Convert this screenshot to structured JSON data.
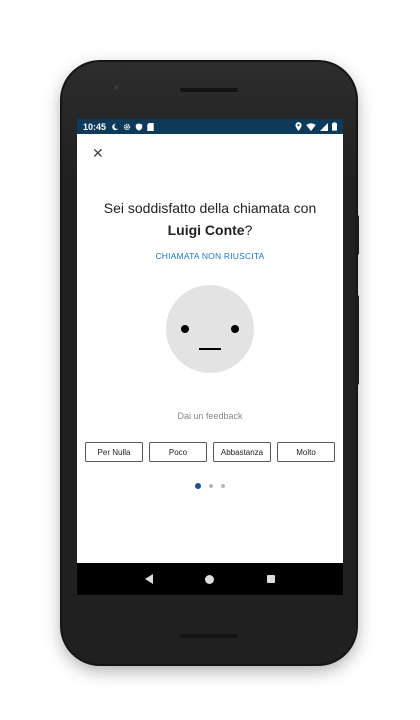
{
  "status_bar": {
    "time": "10:45",
    "left_icons": [
      "moon-icon",
      "settings-icon",
      "shield-icon",
      "sd-card-icon"
    ],
    "right_icons": [
      "location-icon",
      "wifi-icon",
      "signal-icon",
      "battery-icon"
    ]
  },
  "dialog": {
    "question_prefix": "Sei soddisfatto della chiamata con ",
    "contact_name": "Luigi Conte",
    "question_suffix": "?",
    "failed_call_link": "CHIAMATA NON RIUSCITA",
    "feedback_label": "Dai un feedback",
    "options": [
      "Per Nulla",
      "Poco",
      "Abbastanza",
      "Molto"
    ],
    "page_indicator": {
      "current": 1,
      "total": 3
    }
  },
  "navigation": {
    "icons": [
      "back-icon",
      "home-icon",
      "recents-icon"
    ]
  },
  "colors": {
    "status_bar": "#0e3a5a",
    "link": "#1e78c8",
    "indicator_active": "#1d4e9c",
    "face": "#e3e3e3"
  }
}
